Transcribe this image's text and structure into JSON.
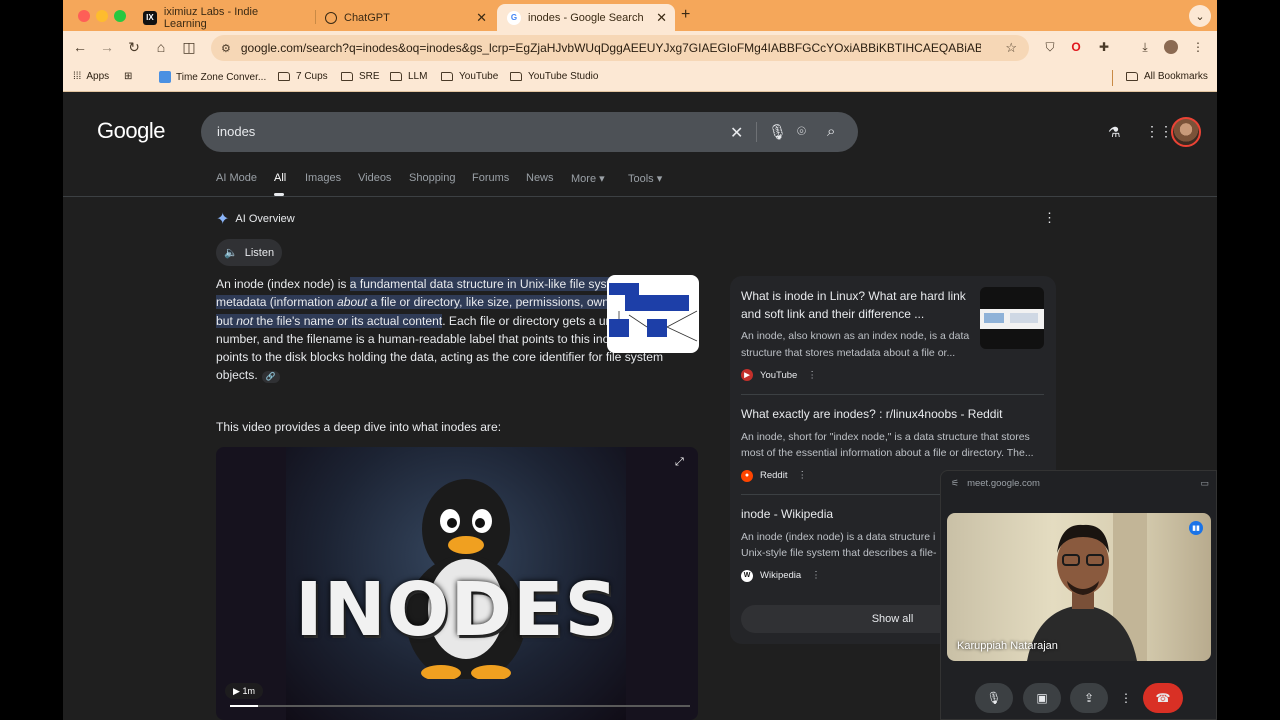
{
  "browser": {
    "tabs": [
      {
        "title": "iximiuz Labs - Indie Learning",
        "favicon": "IX"
      },
      {
        "title": "ChatGPT",
        "favicon": "chatgpt-icon"
      },
      {
        "title": "inodes - Google Search",
        "favicon": "google-icon"
      }
    ],
    "url": "google.com/search?q=inodes&oq=inodes&gs_lcrp=EgZjaHJvbWUqDggAEEUYJxg7GIAEGIoFMg4IABBFGCcYOxiABBiKBTIHCAEQABiABDIHCAIQABiA...",
    "bookmarks": [
      "Apps",
      "Time Zone Conver...",
      "7 Cups",
      "SRE",
      "LLM",
      "YouTube",
      "YouTube Studio"
    ],
    "all_bookmarks": "All Bookmarks"
  },
  "google": {
    "logo": "Google",
    "query": "inodes",
    "tabs": [
      "AI Mode",
      "All",
      "Images",
      "Videos",
      "Shopping",
      "Forums",
      "News",
      "More ▾",
      "Tools ▾"
    ],
    "ai_overview": {
      "heading": "AI Overview",
      "listen": "Listen",
      "p1_a": "An inode (index node) is ",
      "p1_hl1": "a fundamental data structure in Unix-like file systems that stores metadata (information ",
      "p1_hl_em1": "about",
      "p1_hl2": " a file or directory, like size, permissions, owner, timestamps) but ",
      "p1_hl_em2": "not",
      "p1_hl3": " the file's name or its actual content",
      "p1_b": ". Each file or directory gets a unique inode number, and the filename is a human-readable label that points to this inode, which in turn points to the disk blocks holding the data, acting as the core identifier for file system objects.",
      "video_intro": "This video provides a deep dive into what inodes are:",
      "video_title": "INODES",
      "video_duration": "1m"
    },
    "results": [
      {
        "title": "What is inode in Linux? What are hard link and soft link and their difference ...",
        "snippet": "An inode, also known as an index node, is a data structure that stores metadata about a file or...",
        "source": "YouTube"
      },
      {
        "title": "What exactly are inodes? : r/linux4noobs - Reddit",
        "snippet": "An inode, short for \"index node,\" is a data structure that stores most of the essential information about a file or directory. The...",
        "source": "Reddit"
      },
      {
        "title": "inode - Wikipedia",
        "snippet": "An inode (index node) is a data structure i Unix-style file system that describes a file-",
        "source": "Wikipedia"
      }
    ],
    "show_all": "Show all"
  },
  "meet": {
    "domain": "meet.google.com",
    "participant": "Karuppiah Natarajan"
  }
}
